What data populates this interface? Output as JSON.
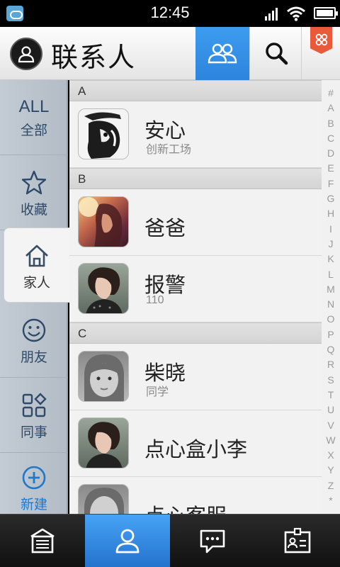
{
  "status": {
    "time": "12:45"
  },
  "header": {
    "title": "联系人"
  },
  "categories": [
    {
      "big": "ALL",
      "label": "全部"
    },
    {
      "label": "收藏"
    },
    {
      "label": "家人"
    },
    {
      "label": "朋友"
    },
    {
      "label": "同事"
    },
    {
      "label": "新建"
    }
  ],
  "sections": [
    {
      "letter": "A",
      "contacts": [
        {
          "name": "安心",
          "sub": "创新工场"
        }
      ]
    },
    {
      "letter": "B",
      "contacts": [
        {
          "name": "爸爸",
          "sub": ""
        },
        {
          "name": "报警",
          "sub": "110"
        }
      ]
    },
    {
      "letter": "C",
      "contacts": [
        {
          "name": "柴晓",
          "sub": "同学"
        },
        {
          "name": "点心盒小李",
          "sub": ""
        },
        {
          "name": "点心客服",
          "sub": ""
        }
      ]
    }
  ],
  "index": [
    "#",
    "A",
    "B",
    "C",
    "D",
    "E",
    "F",
    "G",
    "H",
    "I",
    "J",
    "K",
    "L",
    "M",
    "N",
    "O",
    "P",
    "Q",
    "R",
    "S",
    "T",
    "U",
    "V",
    "W",
    "X",
    "Y",
    "Z",
    "*"
  ],
  "colors": {
    "accent": "#2d84dc",
    "badge": "#e85a3a",
    "category_text": "#2f4a68",
    "new_text": "#1f78c8"
  },
  "bottom_nav": [
    {
      "icon": "building-icon"
    },
    {
      "icon": "person-icon"
    },
    {
      "icon": "message-icon"
    },
    {
      "icon": "id-card-icon"
    }
  ]
}
